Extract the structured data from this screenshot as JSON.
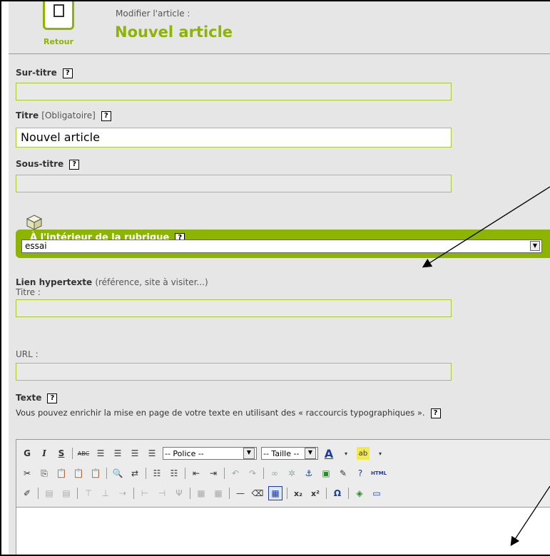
{
  "header": {
    "back_label": "Retour",
    "subtitle": "Modifier l'article :",
    "title": "Nouvel article"
  },
  "fields": {
    "surtitre_label": "Sur-titre",
    "titre_label": "Titre",
    "titre_required": "[Obligatoire]",
    "titre_value": "Nouvel article",
    "soustitre_label": "Sous-titre",
    "help_glyph": "?"
  },
  "rubrique": {
    "label": "À l'intérieur de la rubrique",
    "selected": "essai"
  },
  "lien": {
    "label": "Lien hypertexte",
    "hint": "(référence, site à visiter...)",
    "titre_label": "Titre :",
    "url_label": "URL :"
  },
  "texte": {
    "label": "Texte",
    "description": "Vous pouvez enrichir la mise en page de votre texte en utilisant des « raccourcis typographiques »."
  },
  "editor": {
    "bold": "G",
    "italic": "I",
    "underline": "S",
    "font_select": "-- Police --",
    "size_select": "-- Taille --",
    "html_label": "HTML",
    "subscript": "x₂",
    "superscript": "x²",
    "omega": "Ω"
  },
  "colors": {
    "accent": "#8cb400",
    "field_border": "#a6c933"
  }
}
